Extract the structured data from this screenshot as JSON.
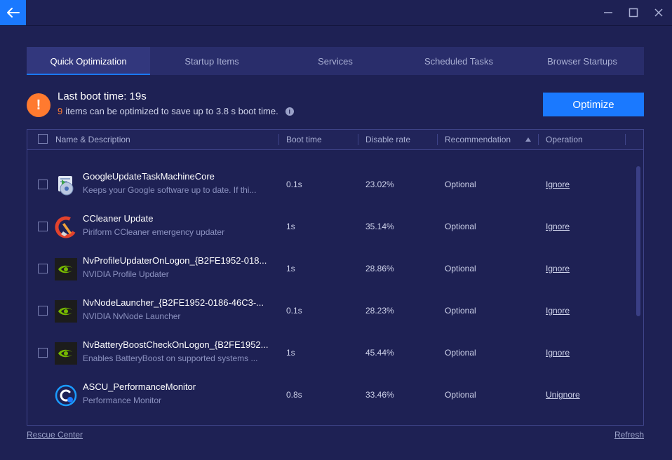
{
  "tabs": [
    {
      "label": "Quick Optimization",
      "active": true
    },
    {
      "label": "Startup Items"
    },
    {
      "label": "Services"
    },
    {
      "label": "Scheduled Tasks"
    },
    {
      "label": "Browser Startups"
    }
  ],
  "summary": {
    "title": "Last boot time: 19s",
    "count": "9",
    "text": "items can be optimized to save up to 3.8 s boot time."
  },
  "optimize_label": "Optimize",
  "columns": {
    "name": "Name & Description",
    "boot": "Boot time",
    "rate": "Disable rate",
    "rec": "Recommendation",
    "op": "Operation"
  },
  "rows": [
    {
      "name": "GoogleUpdateTaskMachineCore",
      "desc": "Keeps your Google software up to date. If thi...",
      "boot": "0.1s",
      "rate": "23.02%",
      "rec": "Optional",
      "op": "Ignore",
      "icon": "google-update-icon"
    },
    {
      "name": "CCleaner Update",
      "desc": "Piriform CCleaner emergency updater",
      "boot": "1s",
      "rate": "35.14%",
      "rec": "Optional",
      "op": "Ignore",
      "icon": "ccleaner-icon"
    },
    {
      "name": "NvProfileUpdaterOnLogon_{B2FE1952-018...",
      "desc": "NVIDIA Profile Updater",
      "boot": "1s",
      "rate": "28.86%",
      "rec": "Optional",
      "op": "Ignore",
      "icon": "nvidia-icon"
    },
    {
      "name": "NvNodeLauncher_{B2FE1952-0186-46C3-...",
      "desc": "NVIDIA NvNode Launcher",
      "boot": "0.1s",
      "rate": "28.23%",
      "rec": "Optional",
      "op": "Ignore",
      "icon": "nvidia-icon"
    },
    {
      "name": "NvBatteryBoostCheckOnLogon_{B2FE1952...",
      "desc": "Enables BatteryBoost on supported systems ...",
      "boot": "1s",
      "rate": "45.44%",
      "rec": "Optional",
      "op": "Ignore",
      "icon": "nvidia-icon"
    },
    {
      "name": "ASCU_PerformanceMonitor",
      "desc": "Performance Monitor",
      "boot": "0.8s",
      "rate": "33.46%",
      "rec": "Optional",
      "op": "Unignore",
      "icon": "ascu-icon"
    }
  ],
  "footer": {
    "rescue": "Rescue Center",
    "refresh": "Refresh"
  },
  "colors": {
    "background": "#1e2154",
    "accent": "#1a79ff",
    "warning": "#ff7a2f"
  }
}
